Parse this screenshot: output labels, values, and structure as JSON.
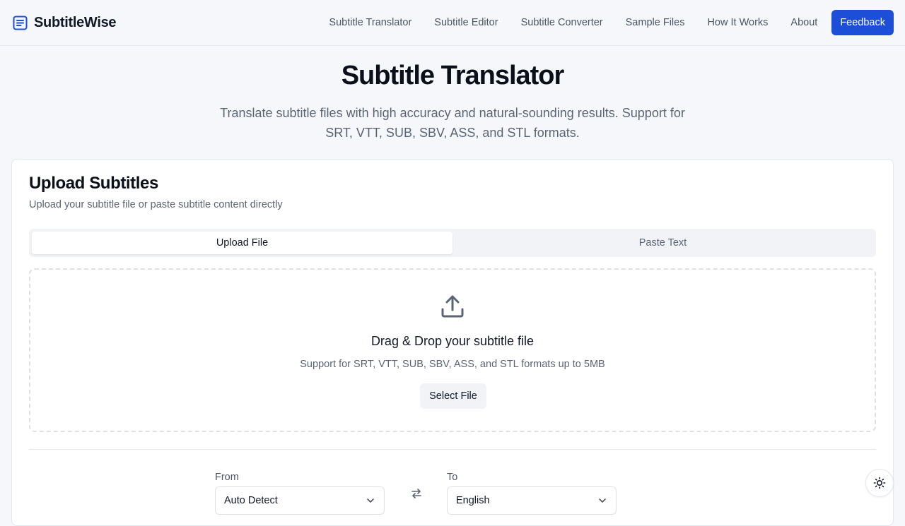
{
  "header": {
    "brand": "SubtitleWise",
    "nav": [
      {
        "label": "Subtitle Translator"
      },
      {
        "label": "Subtitle Editor"
      },
      {
        "label": "Subtitle Converter"
      },
      {
        "label": "Sample Files"
      },
      {
        "label": "How It Works"
      },
      {
        "label": "About"
      }
    ],
    "feedback_label": "Feedback"
  },
  "hero": {
    "title": "Subtitle Translator",
    "subtitle": "Translate subtitle files with high accuracy and natural-sounding results. Support for SRT, VTT, SUB, SBV, ASS, and STL formats."
  },
  "upload_card": {
    "title": "Upload Subtitles",
    "description": "Upload your subtitle file or paste subtitle content directly",
    "tabs": [
      {
        "label": "Upload File",
        "active": true
      },
      {
        "label": "Paste Text",
        "active": false
      }
    ],
    "dropzone": {
      "icon": "upload-icon",
      "title": "Drag & Drop your subtitle file",
      "subtitle": "Support for SRT, VTT, SUB, SBV, ASS, and STL formats up to 5MB",
      "button_label": "Select File"
    }
  },
  "languages": {
    "from_label": "From",
    "from_value": "Auto Detect",
    "to_label": "To",
    "to_value": "English",
    "swap_icon": "swap-arrows-icon"
  },
  "theme_toggle": {
    "icon": "sun-icon"
  },
  "colors": {
    "accent": "#1d4ed8",
    "background": "#f5f7fb",
    "card": "#ffffff",
    "muted_text": "#5b6475"
  }
}
